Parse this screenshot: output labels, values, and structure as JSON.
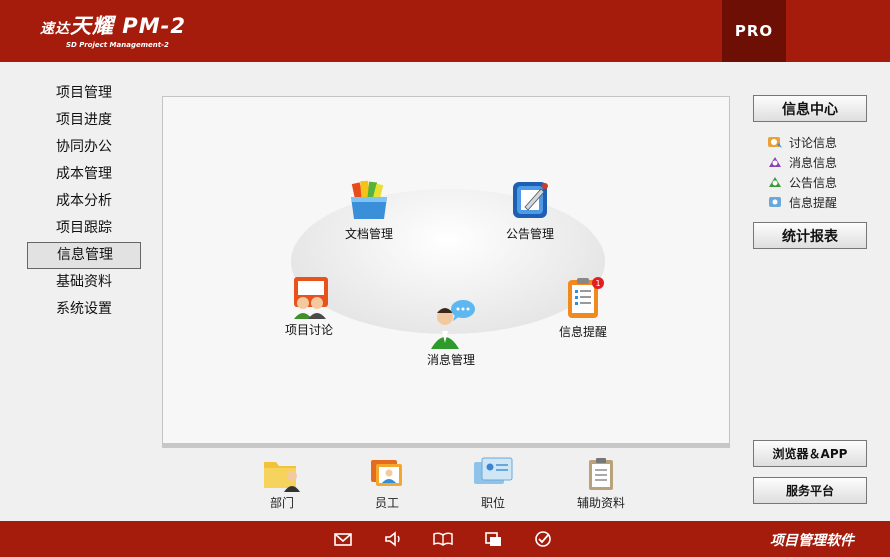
{
  "header": {
    "logo_cn": "速达",
    "logo_name": "天耀 PM-2",
    "logo_sub": "SD Project Management-2",
    "pro_label": "PRO"
  },
  "nav": {
    "items": [
      {
        "label": "项目管理"
      },
      {
        "label": "项目进度"
      },
      {
        "label": "协同办公"
      },
      {
        "label": "成本管理"
      },
      {
        "label": "成本分析"
      },
      {
        "label": "项目跟踪"
      },
      {
        "label": "信息管理",
        "active": true
      },
      {
        "label": "基础资料"
      },
      {
        "label": "系统设置"
      }
    ]
  },
  "main": {
    "modules": {
      "docs": "文档管理",
      "notice": "公告管理",
      "discuss": "项目讨论",
      "message": "消息管理",
      "remind": "信息提醒"
    },
    "remind_badge": "1"
  },
  "right": {
    "info_center": "信息中心",
    "info_items": [
      {
        "label": "讨论信息",
        "icon": "discussion-info-icon"
      },
      {
        "label": "消息信息",
        "icon": "message-info-icon"
      },
      {
        "label": "公告信息",
        "icon": "notice-info-icon"
      },
      {
        "label": "信息提醒",
        "icon": "remind-info-icon"
      }
    ],
    "stats_report": "统计报表",
    "browser_app": "浏览器＆APP",
    "service_platform": "服务平台"
  },
  "bottom": {
    "dept": "部门",
    "staff": "员工",
    "position": "职位",
    "aux": "辅助资料"
  },
  "footer": {
    "icons": [
      "mail-icon",
      "speaker-icon",
      "book-icon",
      "windows-icon",
      "check-icon"
    ],
    "text": "项目管理软件"
  },
  "colors": {
    "brand_red": "#a51c0c",
    "pro_dark": "#6e0f05"
  }
}
